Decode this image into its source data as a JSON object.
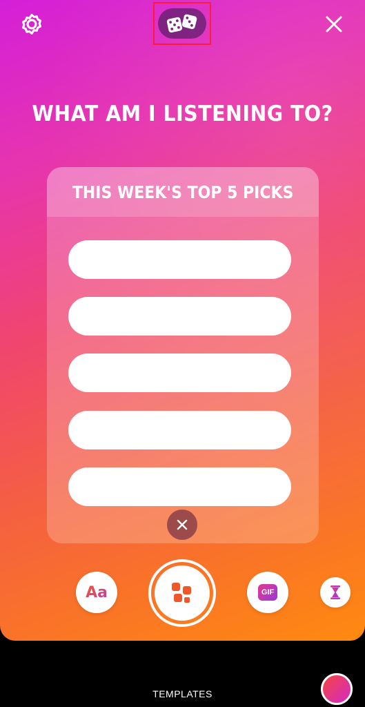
{
  "prompt": {
    "title": "WHAT AM I LISTENING TO?"
  },
  "card": {
    "title": "THIS WEEK'S TOP 5 PICKS",
    "fields": [
      "",
      "",
      "",
      "",
      ""
    ]
  },
  "toolbar": {
    "text_tool_label": "Aa",
    "gif_label": "GIF"
  },
  "bottom": {
    "templates_label": "TEMPLATES"
  },
  "icons": {
    "settings": "gear-icon",
    "dice": "dice-icon",
    "close": "close-icon",
    "card_close": "close-icon",
    "capture": "layout-icon",
    "timer": "hourglass-icon"
  },
  "colors": {
    "dice_pill": "#7a1a7c",
    "highlight": "#ff1230",
    "card_close": "#9c4a4a",
    "capture_accent": "#f0582b"
  }
}
